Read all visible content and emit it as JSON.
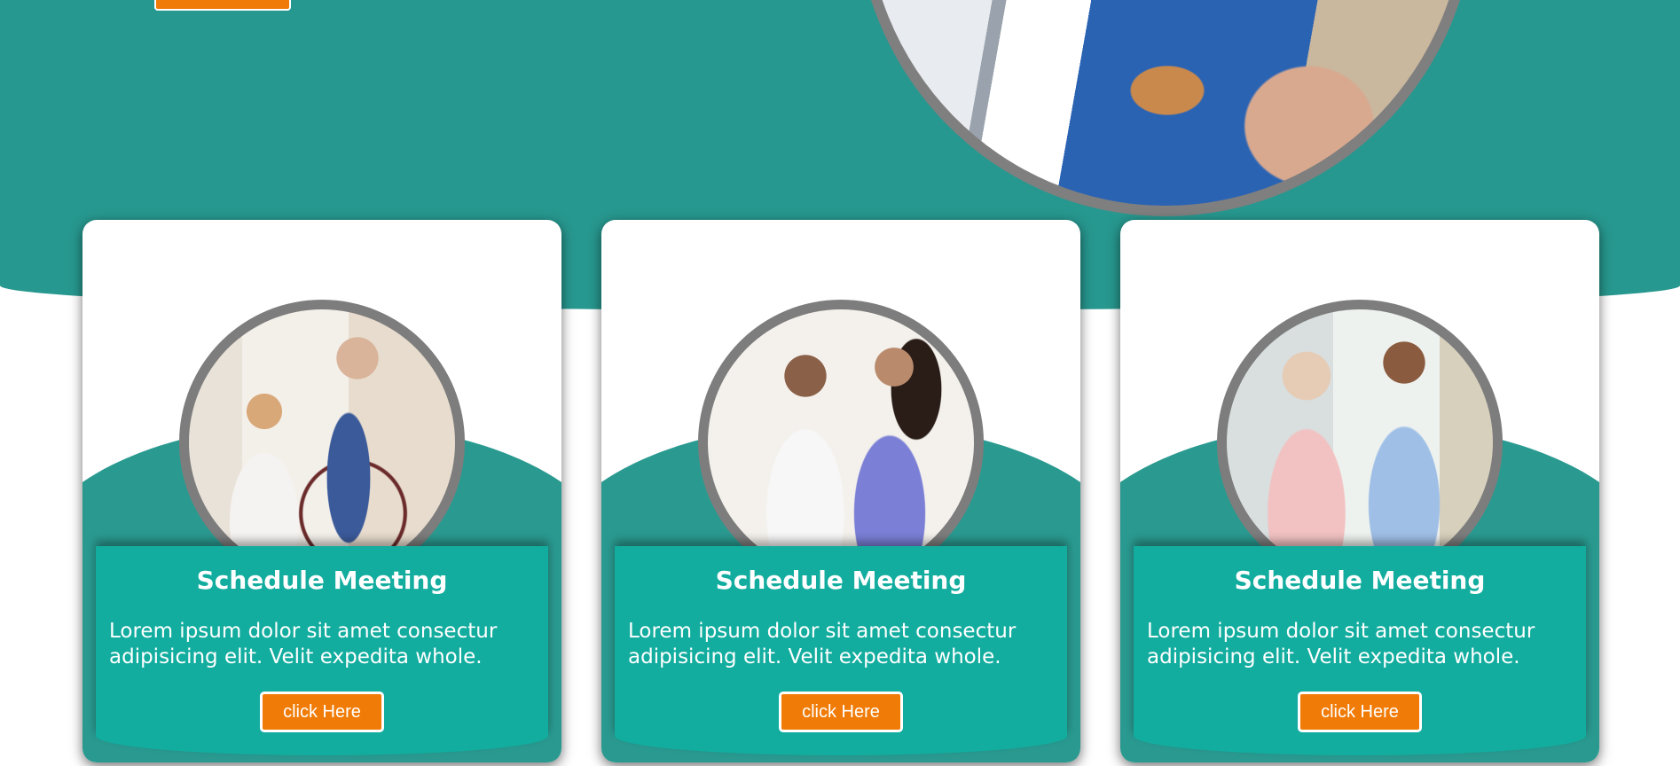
{
  "theme": {
    "teal": "#27988f",
    "panel_teal": "#12ad9f",
    "orange": "#f07b06",
    "frame_gray": "#7d7d7d"
  },
  "hero": {
    "photo_icon": "caregiver-holding-hands-photo"
  },
  "cards": [
    {
      "photo_icon": "caregiver-with-wheelchair-patient-photo",
      "title": "Schedule Meeting",
      "text": "Lorem ipsum dolor sit amet consectur adipisicing elit. Velit expedita whole.",
      "button_label": "click Here"
    },
    {
      "photo_icon": "nurse-with-senior-man-photo",
      "title": "Schedule Meeting",
      "text": "Lorem ipsum dolor sit amet consectur adipisicing elit. Velit expedita whole.",
      "button_label": "click Here"
    },
    {
      "photo_icon": "nurse-with-senior-woman-photo",
      "title": "Schedule Meeting",
      "text": "Lorem ipsum dolor sit amet consectur adipisicing elit. Velit expedita whole.",
      "button_label": "click Here"
    }
  ]
}
